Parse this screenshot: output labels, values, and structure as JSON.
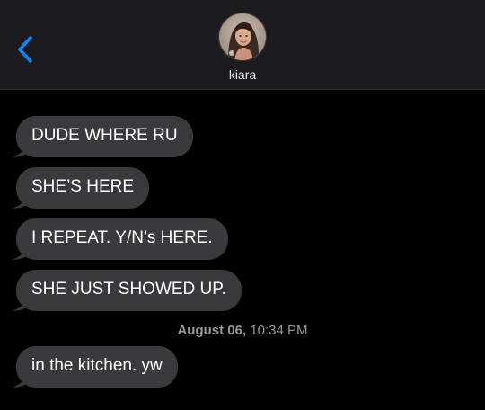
{
  "header": {
    "contact_name": "kiara",
    "back_icon": "chevron-left-icon"
  },
  "messages": [
    {
      "text": "DUDE WHERE RU",
      "direction": "received"
    },
    {
      "text": "SHE’S HERE",
      "direction": "received"
    },
    {
      "text": "I REPEAT. Y/N’s HERE.",
      "direction": "received"
    },
    {
      "text": "SHE JUST SHOWED UP.",
      "direction": "received"
    },
    {
      "text": "in the kitchen. yw",
      "direction": "received"
    }
  ],
  "timestamp": {
    "date": "August 06,",
    "time": "10:34 PM"
  },
  "colors": {
    "background": "#000000",
    "header": "#1c1c1e",
    "bubble": "#3a3a3c",
    "accent": "#0a84ff"
  }
}
